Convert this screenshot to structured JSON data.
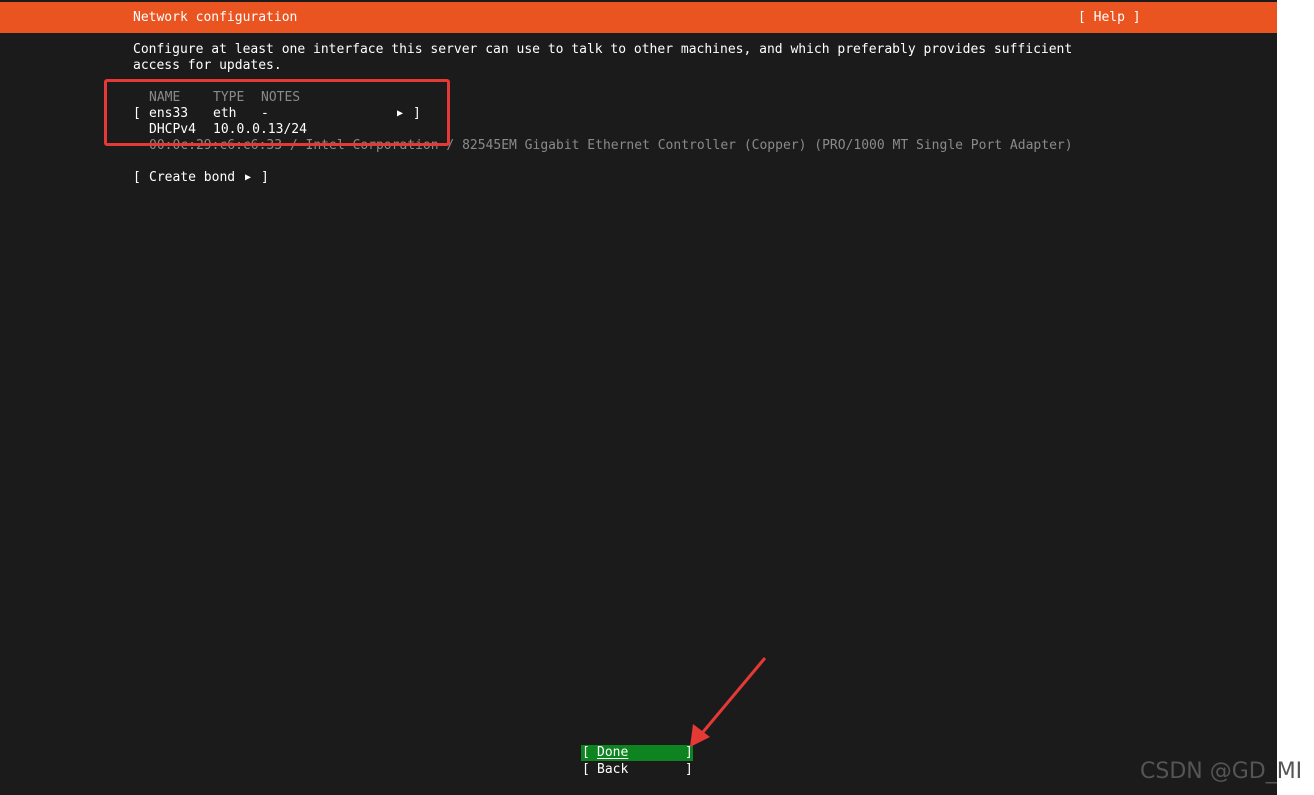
{
  "header": {
    "title": "Network configuration",
    "help_label": "[ Help ]"
  },
  "intro": {
    "line1": "Configure at least one interface this server can use to talk to other machines, and which preferably provides sufficient",
    "line2": "access for updates."
  },
  "table": {
    "columns": [
      "NAME",
      "TYPE",
      "NOTES"
    ],
    "interfaces": [
      {
        "open_bracket": "[",
        "name": "ens33",
        "type": "eth",
        "notes": "-",
        "arrow_icon": "right-triangle",
        "close_bracket": "]",
        "address_method": "DHCPv4",
        "address": "10.0.0.13/24",
        "hardware": "00:0c:29:c6:c6:33 / Intel Corporation / 82545EM Gigabit Ethernet Controller (Copper) (PRO/1000 MT Single Port Adapter)"
      }
    ]
  },
  "create_bond": {
    "open_bracket": "[",
    "label": "Create bond",
    "close_bracket": "]"
  },
  "footer_buttons": {
    "done": {
      "open": "[",
      "label": "Done",
      "close": "]"
    },
    "back": {
      "open": "[",
      "label": "Back",
      "close": "]"
    }
  },
  "watermark": "CSDN @GD_MI",
  "colors": {
    "header_bg": "#e95420",
    "background": "#1b1b1b",
    "selected_button_bg": "#0e8420",
    "annotation_red": "#e53935"
  }
}
